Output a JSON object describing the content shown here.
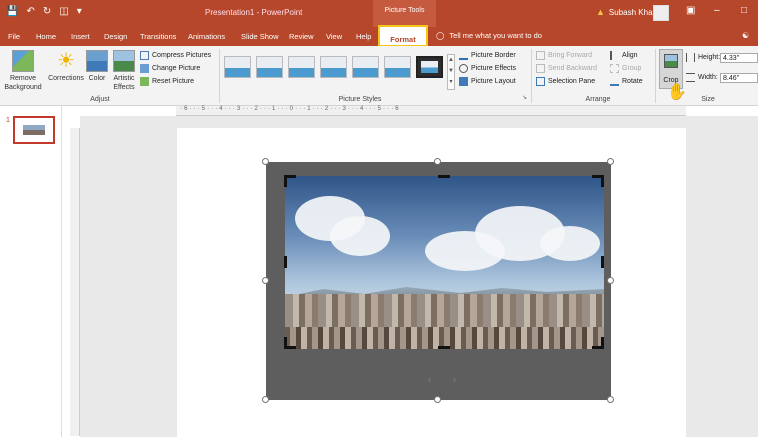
{
  "titlebar": {
    "title": "Presentation1 - PowerPoint",
    "contextual_tab": "Picture Tools",
    "user_name": "Subash Kharel",
    "accent_color": "#b7472a"
  },
  "tabs": [
    "File",
    "Home",
    "Insert",
    "Design",
    "Transitions",
    "Animations",
    "Slide Show",
    "Review",
    "View",
    "Help",
    "Format"
  ],
  "tell_me": "Tell me what you want to do",
  "ribbon": {
    "adjust": {
      "remove_background": "Remove Background",
      "corrections": "Corrections",
      "color": "Color",
      "artistic_effects": "Artistic Effects",
      "compress": "Compress Pictures",
      "change": "Change Picture",
      "reset": "Reset Picture",
      "group_label": "Adjust"
    },
    "styles": {
      "border": "Picture Border",
      "effects": "Picture Effects",
      "layout": "Picture Layout",
      "group_label": "Picture Styles"
    },
    "arrange": {
      "bring_forward": "Bring Forward",
      "send_backward": "Send Backward",
      "selection_pane": "Selection Pane",
      "align": "Align",
      "group": "Group",
      "rotate": "Rotate",
      "group_label": "Arrange"
    },
    "size": {
      "crop": "Crop",
      "height_label": "Height:",
      "height_value": "4.33\"",
      "width_label": "Width:",
      "width_value": "8.46\"",
      "group_label": "Size"
    }
  },
  "ruler": "· 6 · · · 5 · · · 4 · · · 3 · · · 2 · · · 1 · · · 0 · · · 1 · · · 2 · · · 3 · · · 4 · · · 5 · · · 6",
  "thumbnails": {
    "slide_number": "1"
  },
  "nav": {
    "prev": "‹",
    "next": "›"
  }
}
